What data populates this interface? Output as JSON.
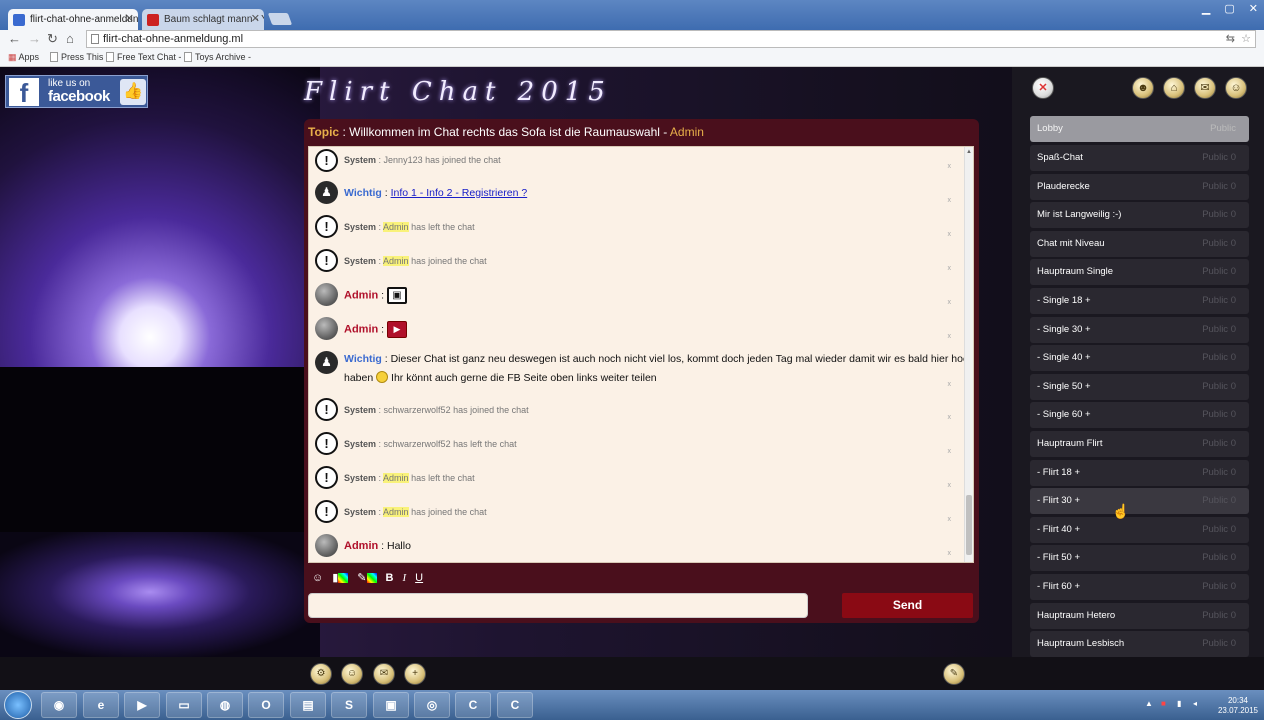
{
  "browser": {
    "tabs": [
      {
        "label": "flirt-chat-ohne-anmeldung",
        "active": true
      },
      {
        "label": "Baum schlagt mann - You",
        "active": false
      }
    ],
    "url": "flirt-chat-ohne-anmeldung.ml",
    "bookmarks": [
      "Apps",
      "Press This",
      "Free Text Chat -",
      "Toys Archive -"
    ]
  },
  "facebook": {
    "line1": "like us on",
    "line2": "facebook"
  },
  "site_title": "Flirt Chat 2015",
  "topic": {
    "label": "Topic",
    "text": "Willkommen im Chat rechts das Sofa ist die Raumauswahl",
    "author": "Admin"
  },
  "messages": [
    {
      "type": "system",
      "who": "System",
      "name": "",
      "text": "Jenny123 has joined the chat"
    },
    {
      "type": "wichtig",
      "who": "Wichtig",
      "link": "Info 1 - Info 2 - Registrieren ?"
    },
    {
      "type": "system",
      "who": "System",
      "name": "Admin",
      "text": "has left the chat"
    },
    {
      "type": "system",
      "who": "System",
      "name": "Admin",
      "text": "has joined the chat"
    },
    {
      "type": "admin-img",
      "who": "Admin"
    },
    {
      "type": "admin-video",
      "who": "Admin"
    },
    {
      "type": "wichtig-long",
      "who": "Wichtig",
      "line1": "Dieser Chat ist ganz neu deswegen ist auch noch nicht viel los, kommt doch jeden Tag mal wieder damit wir es bald hier hochvoll",
      "line2a": "haben",
      "line2b": "Ihr könnt auch gerne die FB Seite oben links weiter teilen"
    },
    {
      "type": "system",
      "who": "System",
      "name": "",
      "text": "schwarzerwolf52 has joined the chat"
    },
    {
      "type": "system",
      "who": "System",
      "name": "",
      "text": "schwarzerwolf52 has left the chat"
    },
    {
      "type": "system",
      "who": "System",
      "name": "Admin",
      "text": "has left the chat"
    },
    {
      "type": "system",
      "who": "System",
      "name": "Admin",
      "text": "has joined the chat"
    },
    {
      "type": "admin-text",
      "who": "Admin",
      "text": "Hallo"
    }
  ],
  "composer": {
    "send_label": "Send"
  },
  "rooms": [
    {
      "name": "Lobby",
      "status": "Public",
      "selected": true
    },
    {
      "name": "Spaß-Chat",
      "status": "Public 0"
    },
    {
      "name": "Plauderecke",
      "status": "Public 0"
    },
    {
      "name": "Mir ist Langweilig :-)",
      "status": "Public 0"
    },
    {
      "name": "Chat mit Niveau",
      "status": "Public 0"
    },
    {
      "name": "Hauptraum Single",
      "status": "Public 0"
    },
    {
      "name": "- Single 18 +",
      "status": "Public 0"
    },
    {
      "name": "- Single 30 +",
      "status": "Public 0"
    },
    {
      "name": "- Single 40 +",
      "status": "Public 0"
    },
    {
      "name": "- Single 50 +",
      "status": "Public 0"
    },
    {
      "name": "- Single 60 +",
      "status": "Public 0"
    },
    {
      "name": "Hauptraum Flirt",
      "status": "Public 0"
    },
    {
      "name": "- Flirt 18 +",
      "status": "Public 0"
    },
    {
      "name": "- Flirt 30 +",
      "status": "Public 0",
      "hovered": true
    },
    {
      "name": "- Flirt 40 +",
      "status": "Public 0"
    },
    {
      "name": "- Flirt 50 +",
      "status": "Public 0"
    },
    {
      "name": "- Flirt 60 +",
      "status": "Public 0"
    },
    {
      "name": "Hauptraum Hetero",
      "status": "Public 0"
    },
    {
      "name": "Hauptraum Lesbisch",
      "status": "Public 0"
    }
  ],
  "clock": {
    "time": "20:34",
    "date": "23.07.2015"
  },
  "colors": {
    "accent": "#8a0a14",
    "topic_label": "#e8b04a",
    "wichtig": "#3a6ad0",
    "admin": "#b0102a"
  }
}
